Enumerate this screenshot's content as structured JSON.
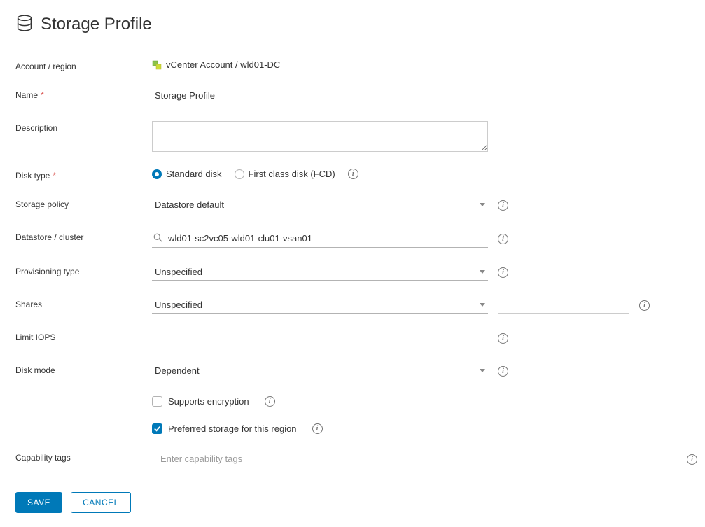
{
  "header": {
    "title": "Storage Profile"
  },
  "labels": {
    "accountRegion": "Account / region",
    "name": "Name",
    "description": "Description",
    "diskType": "Disk type",
    "storagePolicy": "Storage policy",
    "datastore": "Datastore / cluster",
    "provisioningType": "Provisioning type",
    "shares": "Shares",
    "limitIops": "Limit IOPS",
    "diskMode": "Disk mode",
    "capabilityTags": "Capability tags"
  },
  "fields": {
    "accountRegion": "vCenter Account / wld01-DC",
    "name": "Storage Profile",
    "description": "",
    "diskType": {
      "options": {
        "standard": "Standard disk",
        "fcd": "First class disk (FCD)"
      },
      "selected": "standard"
    },
    "storagePolicy": "Datastore default",
    "datastore": "wld01-sc2vc05-wld01-clu01-vsan01",
    "provisioningType": "Unspecified",
    "shares": "Unspecified",
    "limitIops": "",
    "diskMode": "Dependent",
    "supportsEncryption": {
      "label": "Supports encryption",
      "checked": false
    },
    "preferredStorage": {
      "label": "Preferred storage for this region",
      "checked": true
    },
    "capabilityTagsPlaceholder": "Enter capability tags"
  },
  "buttons": {
    "save": "SAVE",
    "cancel": "CANCEL"
  }
}
